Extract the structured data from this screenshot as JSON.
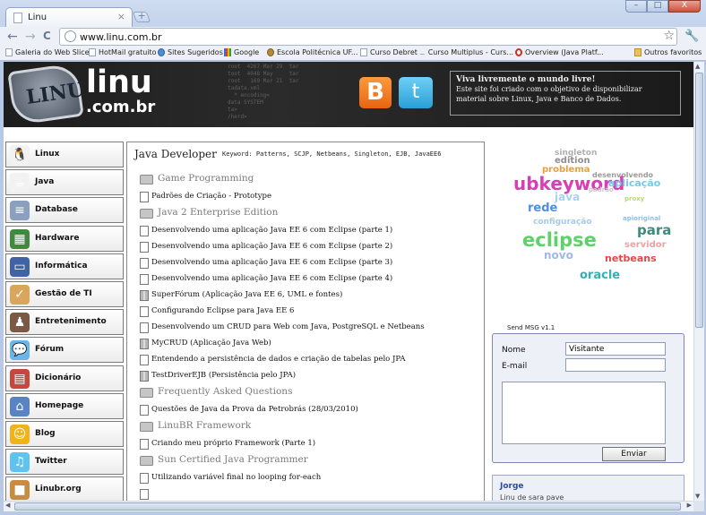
{
  "browser": {
    "tab_title": "Linu",
    "tab_close": "×",
    "new_tab": "+",
    "url": "www.linu.com.br",
    "window_buttons": [
      "–",
      "□",
      "X"
    ],
    "nav": {
      "back": "←",
      "forward": "→",
      "reload": "C"
    },
    "star": "☆",
    "wrench": "🔧",
    "bookmarks": [
      {
        "label": "Galeria do Web Slice",
        "icon": "page"
      },
      {
        "label": "HotMail gratuito",
        "icon": "page"
      },
      {
        "label": "Sites Sugeridos",
        "icon": "ie"
      },
      {
        "label": "Google",
        "icon": "google"
      },
      {
        "label": "Escola Politécnica UF...",
        "icon": "poli"
      },
      {
        "label": "Curso Debret",
        "icon": "page"
      },
      {
        "label": "Curso Multiplus - Curs...",
        "icon": "java"
      },
      {
        "label": "Overview (Java Platf...",
        "icon": "oracle"
      }
    ],
    "other_bookmarks": "Outros favoritos"
  },
  "header": {
    "logo_badge": "LINU",
    "logo_text": "linu",
    "logo_sub": ".com.br",
    "blogger_glyph": "B",
    "twitter_glyph": "t",
    "promo_title": "Viva livremente o mundo livre!",
    "promo_text": "Este site foi criado com o objetivo de disponibilizar material sobre Linux, Java e Banco de Dados.",
    "code_bg": "root  4267 Mar 29  tar\ntoot  4048 May     tar\nroot   169 Mar 21  tar\ntadata.xml\n  * encoding=\ndata SYSTEM\nta>\n/herd>"
  },
  "menu": [
    {
      "label": "Linux",
      "icon": "linux-icon",
      "glyph": "🐧",
      "color": "#f2f2f2"
    },
    {
      "label": "Java",
      "icon": "java-cup-icon",
      "glyph": "☕",
      "color": "#f2f2f2"
    },
    {
      "label": "Database",
      "icon": "database-icon",
      "glyph": "≡",
      "color": "#8aa0bd"
    },
    {
      "label": "Hardware",
      "icon": "hardware-icon",
      "glyph": "▦",
      "color": "#3f8a3f"
    },
    {
      "label": "Informática",
      "icon": "computer-icon",
      "glyph": "▭",
      "color": "#4163a6"
    },
    {
      "label": "Gestão de TI",
      "icon": "checklist-icon",
      "glyph": "✓",
      "color": "#d9a65c"
    },
    {
      "label": "Entretenimento",
      "icon": "joystick-icon",
      "glyph": "♟",
      "color": "#7a5a45"
    },
    {
      "label": "Fórum",
      "icon": "chat-bubbles-icon",
      "glyph": "💬",
      "color": "#6ab6e8"
    },
    {
      "label": "Dicionário",
      "icon": "dictionary-icon",
      "glyph": "▤",
      "color": "#c9463f"
    },
    {
      "label": "Homepage",
      "icon": "homepage-icon",
      "glyph": "⌂",
      "color": "#5a83c4"
    },
    {
      "label": "Blog",
      "icon": "smiley-icon",
      "glyph": "☺",
      "color": "#f2b21c"
    },
    {
      "label": "Twitter",
      "icon": "bird-icon",
      "glyph": "♫",
      "color": "#5ec3ee"
    },
    {
      "label": "Linubr.org",
      "icon": "box-icon",
      "glyph": "■",
      "color": "#c98b3c"
    }
  ],
  "content": {
    "title": "Java Developer",
    "keywords": "Keyword: Patterns, SCJP, Netbeans, Singleton, EJB, JavaEE6",
    "categories": [
      {
        "name": "Game Programming",
        "articles": [
          {
            "t": "Padrões de Criação - Prototype",
            "k": "page"
          }
        ]
      },
      {
        "name": "Java 2 Enterprise Edition",
        "articles": [
          {
            "t": "Desenvolvendo uma aplicação Java EE 6 com Eclipse (parte 1)",
            "k": "page"
          },
          {
            "t": "Desenvolvendo uma aplicação Java EE 6 com Eclipse (parte 2)",
            "k": "page"
          },
          {
            "t": "Desenvolvendo uma aplicação Java EE 6 com Eclipse (parte 3)",
            "k": "page"
          },
          {
            "t": "Desenvolvendo uma aplicação Java EE 6 com Eclipse (parte 4)",
            "k": "page"
          },
          {
            "t": "SuperFórum (Aplicação Java EE 6, UML e fontes)",
            "k": "sq"
          },
          {
            "t": "Configurando Eclipse para Java EE 6",
            "k": "page"
          },
          {
            "t": "Desenvolvendo um CRUD para Web com Java, PostgreSQL e Netbeans",
            "k": "page"
          },
          {
            "t": "MyCRUD (Aplicação Java Web)",
            "k": "sq"
          },
          {
            "t": "Entendendo a persistência de dados e criação de tabelas pelo JPA",
            "k": "page"
          },
          {
            "t": "TestDriverEJB (Persistência pelo JPA)",
            "k": "sq"
          }
        ]
      },
      {
        "name": "Frequently Asked Questions",
        "articles": [
          {
            "t": "Questões de Java da Prova da Petrobrás (28/03/2010)",
            "k": "page"
          }
        ]
      },
      {
        "name": "LinuBR Framework",
        "articles": [
          {
            "t": "Criando meu próprio Framework (Parte 1)",
            "k": "page"
          }
        ]
      },
      {
        "name": "Sun Certified Java Programmer",
        "articles": [
          {
            "t": "Utilizando variável final no looping for-each",
            "k": "page"
          },
          {
            "t": "",
            "k": "page"
          }
        ]
      }
    ]
  },
  "tag_cloud": [
    {
      "w": "singleton",
      "c": "#b0b0b0",
      "s": 9
    },
    {
      "w": "edition",
      "c": "#8e8e8e",
      "s": 10
    },
    {
      "w": "problema",
      "c": "#f0a02c",
      "s": 10
    },
    {
      "w": "desenvolvendo",
      "c": "#9a9a9a",
      "s": 8
    },
    {
      "w": "ubkeyword",
      "c": "#d83fb7",
      "s": 20
    },
    {
      "w": "aplicação",
      "c": "#7ec5e8",
      "s": 11
    },
    {
      "w": "padrão",
      "c": "#c8c8c8",
      "s": 7
    },
    {
      "w": "java",
      "c": "#a9d2ee",
      "s": 12
    },
    {
      "w": "proxy",
      "c": "#b6d97a",
      "s": 7
    },
    {
      "w": "rede",
      "c": "#4f8fd8",
      "s": 13
    },
    {
      "w": "configuração",
      "c": "#a8c8ef",
      "s": 9
    },
    {
      "w": "apioriginal",
      "c": "#8fbde6",
      "s": 7
    },
    {
      "w": "para",
      "c": "#3e8a7d",
      "s": 15
    },
    {
      "w": "eclipse",
      "c": "#5fd16a",
      "s": 21
    },
    {
      "w": "servidor",
      "c": "#f0a0a0",
      "s": 10
    },
    {
      "w": "novo",
      "c": "#9fb8e8",
      "s": 12
    },
    {
      "w": "netbeans",
      "c": "#e54646",
      "s": 11
    },
    {
      "w": "oracle",
      "c": "#35b0b3",
      "s": 13
    }
  ],
  "shoutbox": {
    "version": "Send MSG v1.1",
    "name_label": "Nome",
    "name_value": "Visitante",
    "email_label": "E-mail",
    "email_value": "",
    "message_value": "",
    "send_label": "Enviar",
    "last_author": "Jorge",
    "last_message": "Linu de sara pave"
  }
}
